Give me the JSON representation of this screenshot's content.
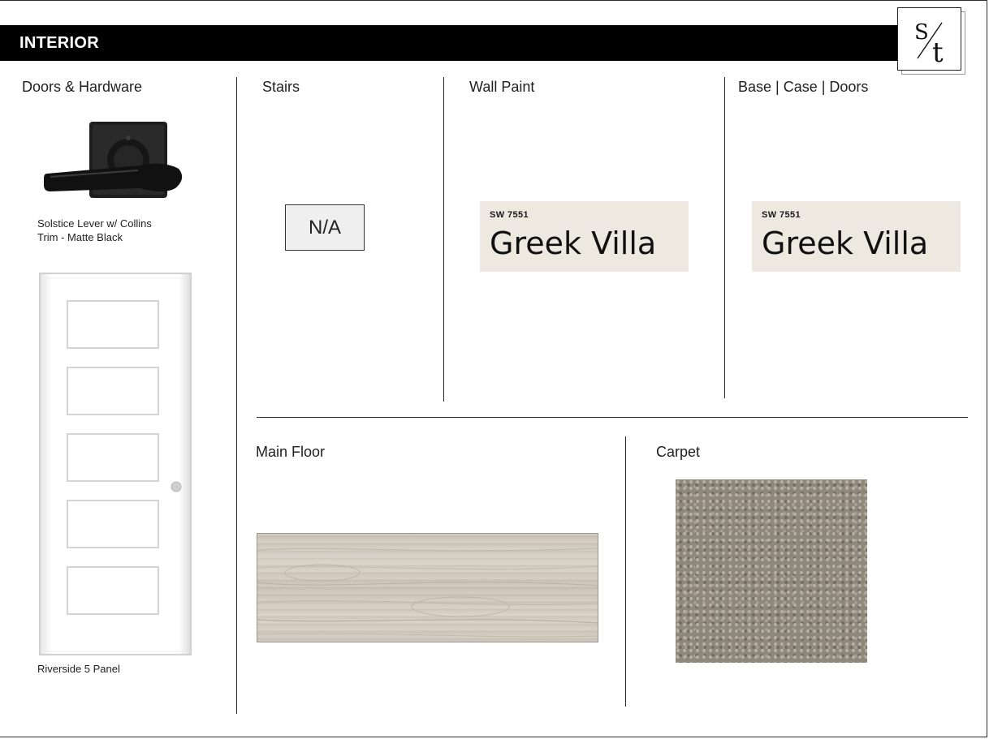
{
  "header": {
    "title": "INTERIOR",
    "logo_text": "S/t"
  },
  "sections": {
    "doors_hardware": {
      "heading": "Doors & Hardware",
      "hardware_caption_line1": "Solstice Lever w/ Collins",
      "hardware_caption_line2": "Trim - Matte Black",
      "door_caption": "Riverside 5 Panel"
    },
    "stairs": {
      "heading": "Stairs",
      "value": "N/A"
    },
    "wall_paint": {
      "heading": "Wall Paint",
      "code": "SW 7551",
      "name": "Greek Villa",
      "color": "#ede8e0"
    },
    "base_case_doors": {
      "heading": "Base | Case | Doors",
      "code": "SW 7551",
      "name": "Greek Villa",
      "color": "#ede8e0"
    },
    "main_floor": {
      "heading": "Main Floor"
    },
    "carpet": {
      "heading": "Carpet"
    }
  },
  "colors": {
    "banner": "#000000",
    "text": "#1f1f1f"
  }
}
